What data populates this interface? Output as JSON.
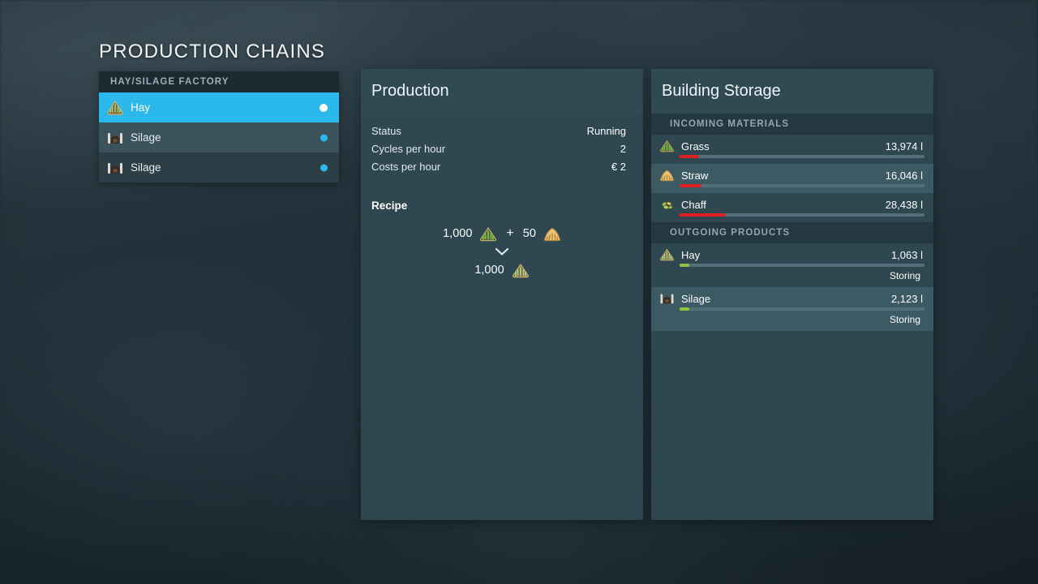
{
  "page": {
    "title": "PRODUCTION CHAINS",
    "accent_color": "#2bb8ea",
    "panel_color": "#2e4750",
    "bar_low_color": "#e02020",
    "bar_ok_color": "#8cc63f"
  },
  "chain_list": {
    "header": "HAY/SILAGE FACTORY",
    "items": [
      {
        "label": "Hay",
        "icon": "hay-icon",
        "selected": true,
        "status_dot": "active"
      },
      {
        "label": "Silage",
        "icon": "silage-icon",
        "selected": false,
        "status_dot": "active"
      },
      {
        "label": "Silage",
        "icon": "silage-icon",
        "selected": false,
        "status_dot": "active"
      }
    ]
  },
  "production": {
    "title": "Production",
    "stats": [
      {
        "label": "Status",
        "value": "Running"
      },
      {
        "label": "Cycles per hour",
        "value": "2"
      },
      {
        "label": "Costs per hour",
        "value": "€ 2"
      }
    ],
    "recipe": {
      "title": "Recipe",
      "inputs": [
        {
          "amount": "1,000",
          "icon": "grass-icon"
        },
        {
          "amount": "50",
          "icon": "straw-icon"
        }
      ],
      "plus": "+",
      "arrow": "chevron-down-icon",
      "outputs": [
        {
          "amount": "1,000",
          "icon": "hay-icon"
        }
      ]
    }
  },
  "storage": {
    "title": "Building Storage",
    "sections": [
      {
        "header": "INCOMING MATERIALS",
        "rows": [
          {
            "name": "Grass",
            "icon": "grass-icon",
            "value": "13,974 l",
            "fill_pct": 8,
            "fill_color": "#e02020",
            "sub": ""
          },
          {
            "name": "Straw",
            "icon": "straw-icon",
            "value": "16,046 l",
            "fill_pct": 9,
            "fill_color": "#e02020",
            "sub": ""
          },
          {
            "name": "Chaff",
            "icon": "chaff-icon",
            "value": "28,438 l",
            "fill_pct": 19,
            "fill_color": "#e02020",
            "sub": ""
          }
        ]
      },
      {
        "header": "OUTGOING PRODUCTS",
        "rows": [
          {
            "name": "Hay",
            "icon": "hay-icon",
            "value": "1,063 l",
            "fill_pct": 4,
            "fill_color": "#8cc63f",
            "sub": "Storing"
          },
          {
            "name": "Silage",
            "icon": "silage-icon",
            "value": "2,123 l",
            "fill_pct": 4,
            "fill_color": "#8cc63f",
            "sub": "Storing"
          }
        ]
      }
    ]
  }
}
